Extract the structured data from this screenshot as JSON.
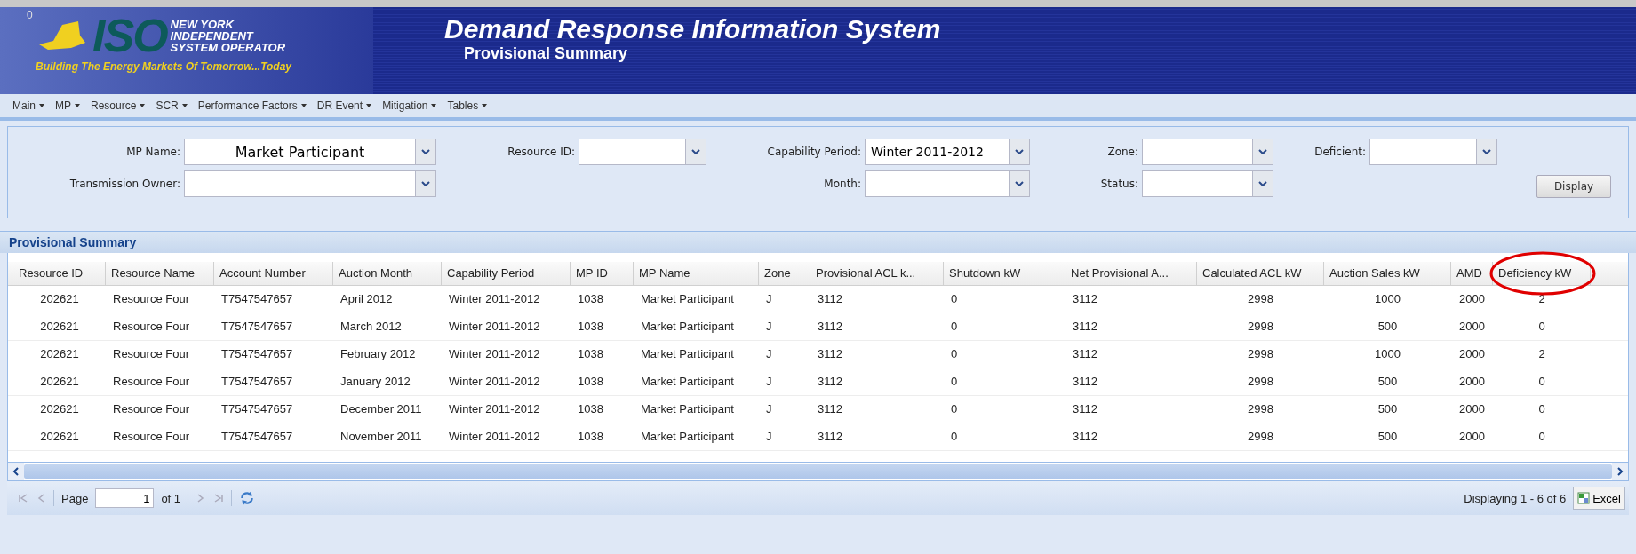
{
  "banner": {
    "corner_mark": "0",
    "logo_letters": "ISO",
    "logo_lines": [
      "NEW YORK",
      "INDEPENDENT",
      "SYSTEM OPERATOR"
    ],
    "tagline": "Building The Energy Markets Of Tomorrow...Today",
    "title": "Demand Response Information System",
    "subtitle": "Provisional Summary"
  },
  "menu": [
    "Main",
    "MP",
    "Resource",
    "SCR",
    "Performance Factors",
    "DR Event",
    "Mitigation",
    "Tables"
  ],
  "filters": [
    {
      "label": "MP Name:",
      "value": "Market Participant"
    },
    {
      "label": "Resource ID:"
    },
    {
      "label": "Capability Period:",
      "value": "Winter 2011-2012"
    },
    {
      "label": "Zone:"
    },
    {
      "label": "Deficient:"
    },
    {
      "label": "Transmission Owner:"
    },
    {
      "label": "Month:"
    },
    {
      "label": "Status:"
    }
  ],
  "display_button": "Display",
  "panel_title": "Provisional Summary",
  "table": {
    "columns": [
      {
        "label": "Resource ID",
        "circled": false
      },
      {
        "label": "Resource Name",
        "circled": false
      },
      {
        "label": "Account Number",
        "circled": false
      },
      {
        "label": "Auction Month",
        "circled": false
      },
      {
        "label": "Capability Period",
        "circled": false
      },
      {
        "label": "MP ID",
        "circled": false
      },
      {
        "label": "MP Name",
        "circled": false
      },
      {
        "label": "Zone",
        "circled": false
      },
      {
        "label": "Provisional ACL k...",
        "circled": false
      },
      {
        "label": "Shutdown kW",
        "circled": false
      },
      {
        "label": "Net Provisional A...",
        "circled": false
      },
      {
        "label": "Calculated ACL kW",
        "circled": false
      },
      {
        "label": "Auction Sales kW",
        "circled": false
      },
      {
        "label": "AMD",
        "circled": false
      },
      {
        "label": "Deficiency kW",
        "circled": true
      }
    ],
    "rows": [
      [
        "202621",
        "Resource Four",
        "T7547547657",
        "April 2012",
        "Winter 2011-2012",
        "1038",
        "Market Participant",
        "J",
        "3112",
        "0",
        "3112",
        "2998",
        "1000",
        "2000",
        "2"
      ],
      [
        "202621",
        "Resource Four",
        "T7547547657",
        "March 2012",
        "Winter 2011-2012",
        "1038",
        "Market Participant",
        "J",
        "3112",
        "0",
        "3112",
        "2998",
        "500",
        "2000",
        "0"
      ],
      [
        "202621",
        "Resource Four",
        "T7547547657",
        "February 2012",
        "Winter 2011-2012",
        "1038",
        "Market Participant",
        "J",
        "3112",
        "0",
        "3112",
        "2998",
        "1000",
        "2000",
        "2"
      ],
      [
        "202621",
        "Resource Four",
        "T7547547657",
        "January 2012",
        "Winter 2011-2012",
        "1038",
        "Market Participant",
        "J",
        "3112",
        "0",
        "3112",
        "2998",
        "500",
        "2000",
        "0"
      ],
      [
        "202621",
        "Resource Four",
        "T7547547657",
        "December 2011",
        "Winter 2011-2012",
        "1038",
        "Market Participant",
        "J",
        "3112",
        "0",
        "3112",
        "2998",
        "500",
        "2000",
        "0"
      ],
      [
        "202621",
        "Resource Four",
        "T7547547657",
        "November 2011",
        "Winter 2011-2012",
        "1038",
        "Market Participant",
        "J",
        "3112",
        "0",
        "3112",
        "2998",
        "500",
        "2000",
        "0"
      ]
    ]
  },
  "paging": {
    "page_label": "Page",
    "page_value": "1",
    "of_label": "of 1",
    "summary": "Displaying 1 - 6 of 6",
    "excel_button": "Excel"
  }
}
